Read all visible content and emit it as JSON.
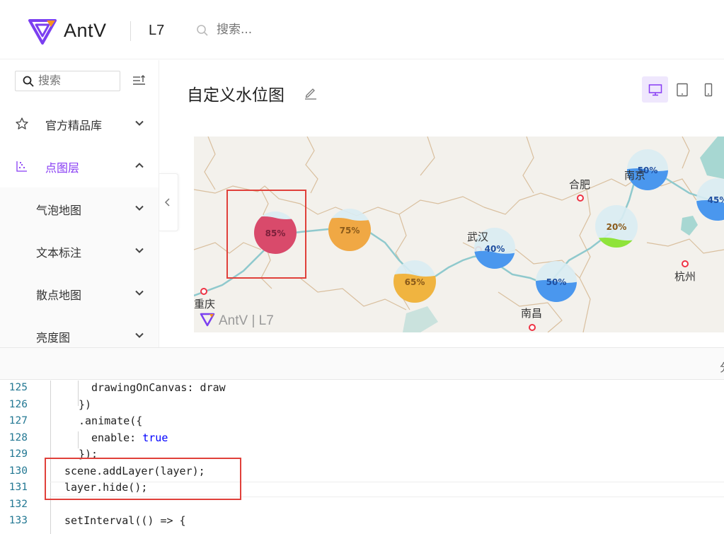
{
  "header": {
    "brand": "AntV",
    "product": "L7",
    "search_placeholder": "搜索..."
  },
  "sidebar": {
    "search_placeholder": "搜索",
    "items": [
      {
        "label": "官方精品库"
      },
      {
        "label": "点图层"
      }
    ],
    "subitems": [
      {
        "label": "气泡地图"
      },
      {
        "label": "文本标注"
      },
      {
        "label": "散点地图"
      },
      {
        "label": "亮度图"
      }
    ]
  },
  "main": {
    "title": "自定义水位图"
  },
  "map": {
    "cities": [
      {
        "name": "合肥"
      },
      {
        "name": "南京"
      },
      {
        "name": "武汉"
      },
      {
        "name": "杭州"
      },
      {
        "name": "南昌"
      },
      {
        "name": "重庆"
      }
    ],
    "gauges": [
      {
        "label": "85%",
        "value": 0.85,
        "color": "#d94a6b"
      },
      {
        "label": "75%",
        "value": 0.75,
        "color": "#f0a844"
      },
      {
        "label": "65%",
        "value": 0.65,
        "color": "#f0b440"
      },
      {
        "label": "40%",
        "value": 0.4,
        "color": "#4a97ee"
      },
      {
        "label": "50%",
        "value": 0.5,
        "color": "#4a97ee"
      },
      {
        "label": "20%",
        "value": 0.2,
        "color": "#8fe33a"
      },
      {
        "label": "50%",
        "value": 0.5,
        "color": "#4a97ee"
      },
      {
        "label": "45%",
        "value": 0.45,
        "color": "#4a97ee"
      }
    ],
    "watermark": "AntV | L7"
  },
  "toolbar": {
    "right_glyph": "分"
  },
  "code": {
    "lines": [
      {
        "no": "125",
        "text": "drawingOnCanvas: draw"
      },
      {
        "no": "126",
        "text": "})"
      },
      {
        "no": "127",
        "text": ".animate({"
      },
      {
        "no": "128",
        "key": "enable: ",
        "value": "true"
      },
      {
        "no": "129",
        "text": "});"
      },
      {
        "no": "130",
        "text": "scene.addLayer(layer);"
      },
      {
        "no": "131",
        "text": "layer.hide();"
      },
      {
        "no": "132",
        "text": ""
      },
      {
        "no": "133",
        "text": "setInterval(() => {"
      }
    ]
  },
  "colors": {
    "accent": "#873bf4",
    "highlight": "#e0403a",
    "line_number": "#237893",
    "keyword": "#0000ff"
  }
}
